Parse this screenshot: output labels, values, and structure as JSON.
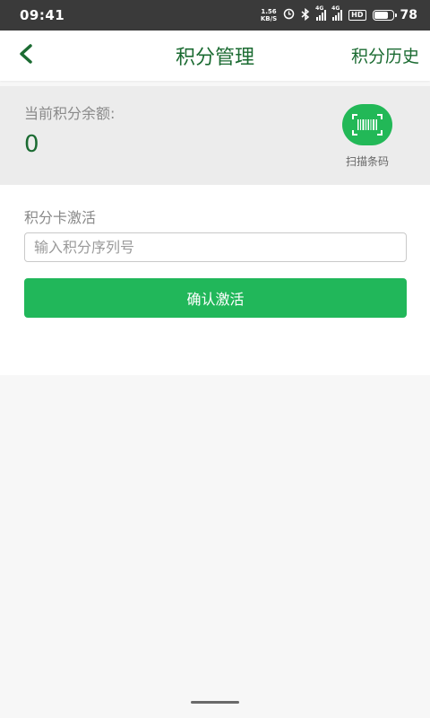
{
  "status_bar": {
    "time": "09:41",
    "net_speed_value": "1.56",
    "net_speed_unit": "KB/S",
    "signal1_tag": "4G",
    "signal2_tag": "4G",
    "hd_label": "HD",
    "battery_percent": 78,
    "battery_text": "78"
  },
  "nav": {
    "title": "积分管理",
    "right_link": "积分历史"
  },
  "balance": {
    "label": "当前积分余额:",
    "value": "0",
    "scan_label": "扫描条码"
  },
  "activation": {
    "section_title": "积分卡激活",
    "input_placeholder": "输入积分序列号",
    "input_value": "",
    "confirm_label": "确认激活"
  },
  "colors": {
    "brand_green": "#1b6b32",
    "button_green": "#21b75a"
  }
}
